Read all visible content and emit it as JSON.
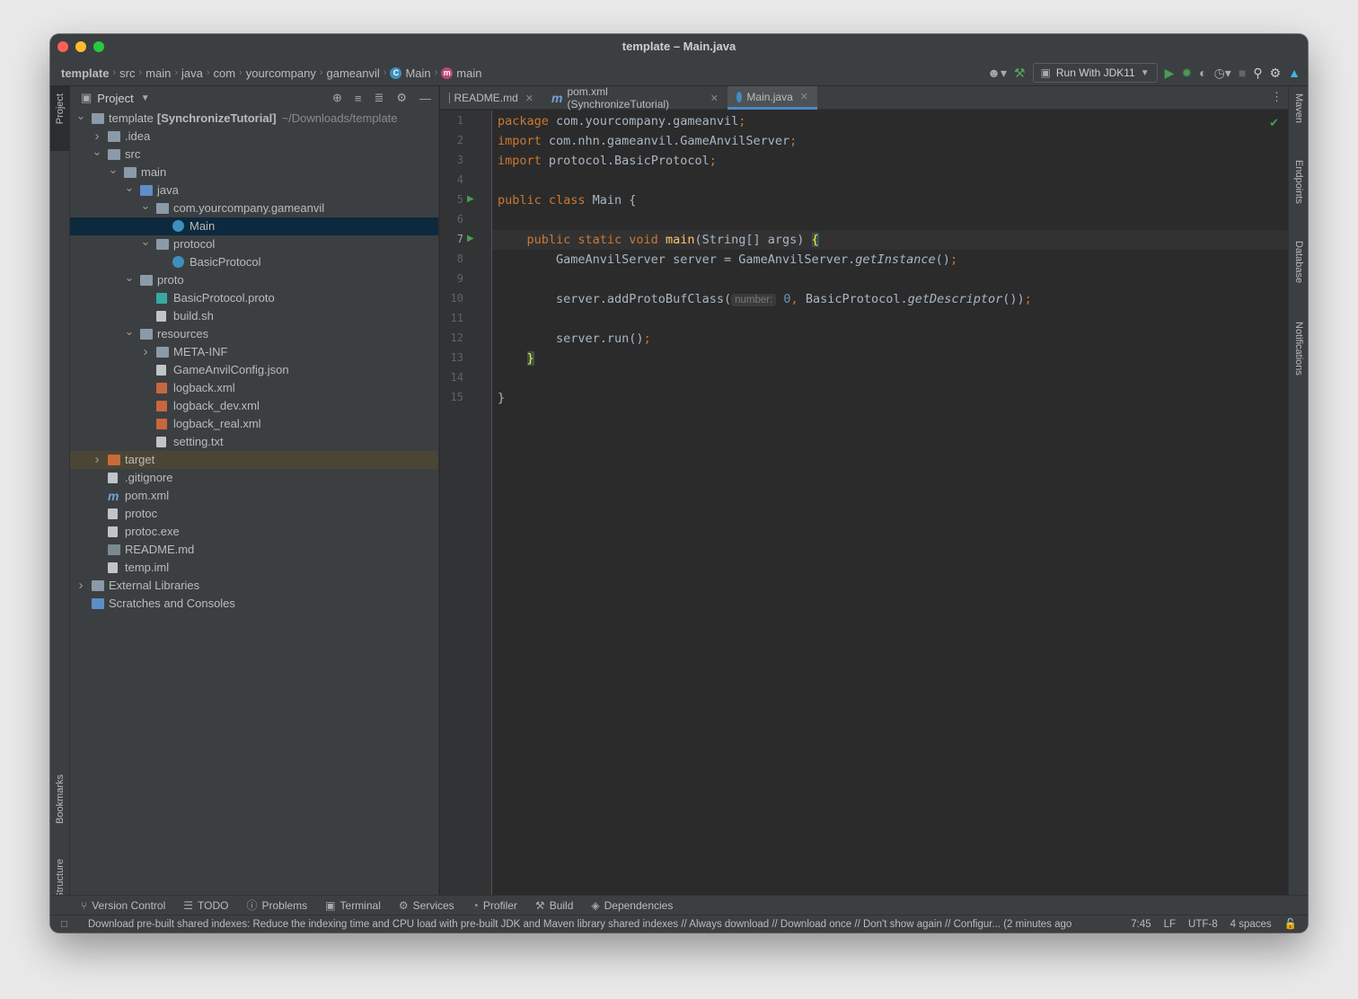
{
  "window": {
    "title": "template – Main.java"
  },
  "breadcrumbs": [
    "template",
    "src",
    "main",
    "java",
    "com",
    "yourcompany",
    "gameanvil",
    "Main",
    "main"
  ],
  "toolbar": {
    "run_config": "Run With JDK11"
  },
  "left_strip": {
    "project": "Project",
    "bookmarks": "Bookmarks",
    "structure": "Structure"
  },
  "right_strip": {
    "maven": "Maven",
    "endpoints": "Endpoints",
    "database": "Database",
    "notifications": "Notifications"
  },
  "project_panel": {
    "title": "Project",
    "tree": [
      {
        "depth": 0,
        "arrow": "open",
        "icon": "module-folder",
        "label": "template",
        "bold": "[SynchronizeTutorial]",
        "dim": "~/Downloads/template"
      },
      {
        "depth": 1,
        "arrow": "closed",
        "icon": "folder",
        "label": ".idea"
      },
      {
        "depth": 1,
        "arrow": "open",
        "icon": "folder",
        "label": "src"
      },
      {
        "depth": 2,
        "arrow": "open",
        "icon": "folder",
        "label": "main"
      },
      {
        "depth": 3,
        "arrow": "open",
        "icon": "folder-blue",
        "label": "java"
      },
      {
        "depth": 4,
        "arrow": "open",
        "icon": "package",
        "label": "com.yourcompany.gameanvil"
      },
      {
        "depth": 5,
        "arrow": "",
        "icon": "class",
        "label": "Main",
        "selected": true
      },
      {
        "depth": 4,
        "arrow": "open",
        "icon": "package",
        "label": "protocol"
      },
      {
        "depth": 5,
        "arrow": "",
        "icon": "class",
        "label": "BasicProtocol"
      },
      {
        "depth": 3,
        "arrow": "open",
        "icon": "folder",
        "label": "proto"
      },
      {
        "depth": 4,
        "arrow": "",
        "icon": "proto",
        "label": "BasicProtocol.proto"
      },
      {
        "depth": 4,
        "arrow": "",
        "icon": "script",
        "label": "build.sh"
      },
      {
        "depth": 3,
        "arrow": "open",
        "icon": "folder-res",
        "label": "resources"
      },
      {
        "depth": 4,
        "arrow": "closed",
        "icon": "folder",
        "label": "META-INF"
      },
      {
        "depth": 4,
        "arrow": "",
        "icon": "json",
        "label": "GameAnvilConfig.json"
      },
      {
        "depth": 4,
        "arrow": "",
        "icon": "xml",
        "label": "logback.xml"
      },
      {
        "depth": 4,
        "arrow": "",
        "icon": "xml",
        "label": "logback_dev.xml"
      },
      {
        "depth": 4,
        "arrow": "",
        "icon": "xml",
        "label": "logback_real.xml"
      },
      {
        "depth": 4,
        "arrow": "",
        "icon": "text",
        "label": "setting.txt"
      },
      {
        "depth": 1,
        "arrow": "closed",
        "icon": "folder-orange",
        "label": "target",
        "target": true
      },
      {
        "depth": 1,
        "arrow": "",
        "icon": "gitignore",
        "label": ".gitignore"
      },
      {
        "depth": 1,
        "arrow": "",
        "icon": "maven",
        "label": "pom.xml"
      },
      {
        "depth": 1,
        "arrow": "",
        "icon": "file",
        "label": "protoc"
      },
      {
        "depth": 1,
        "arrow": "",
        "icon": "file",
        "label": "protoc.exe"
      },
      {
        "depth": 1,
        "arrow": "",
        "icon": "md",
        "label": "README.md"
      },
      {
        "depth": 1,
        "arrow": "",
        "icon": "iml",
        "label": "temp.iml"
      },
      {
        "depth": 0,
        "arrow": "closed",
        "icon": "libraries",
        "label": "External Libraries"
      },
      {
        "depth": 0,
        "arrow": "",
        "icon": "scratches",
        "label": "Scratches and Consoles"
      }
    ]
  },
  "tabs": [
    {
      "label": "README.md",
      "icon": "md"
    },
    {
      "label": "pom.xml (SynchronizeTutorial)",
      "icon": "maven"
    },
    {
      "label": "Main.java",
      "icon": "class",
      "active": true
    }
  ],
  "editor": {
    "current_line": 7,
    "lines": [
      {
        "n": "1",
        "t": [
          [
            "kw",
            "package "
          ],
          [
            "",
            "com.yourcompany.gameanvil"
          ],
          [
            "kw",
            ";"
          ]
        ]
      },
      {
        "n": "2",
        "t": [
          [
            "kw",
            "import "
          ],
          [
            "",
            "com.nhn.gameanvil.GameAnvilServer"
          ],
          [
            "kw",
            ";"
          ]
        ]
      },
      {
        "n": "3",
        "t": [
          [
            "kw",
            "import "
          ],
          [
            "",
            "protocol.BasicProtocol"
          ],
          [
            "kw",
            ";"
          ]
        ]
      },
      {
        "n": "4",
        "t": []
      },
      {
        "n": "5",
        "run": true,
        "t": [
          [
            "kw",
            "public class "
          ],
          [
            "",
            "Main {"
          ]
        ]
      },
      {
        "n": "6",
        "t": []
      },
      {
        "n": "7",
        "run": true,
        "t": [
          [
            "",
            "    "
          ],
          [
            "kw",
            "public static void "
          ],
          [
            "fn",
            "main"
          ],
          [
            "",
            "(String[] args) "
          ],
          [
            "brace",
            "{"
          ]
        ]
      },
      {
        "n": "8",
        "t": [
          [
            "",
            "        GameAnvilServer server = GameAnvilServer."
          ],
          [
            "it",
            "getInstance"
          ],
          [
            "",
            "()"
          ],
          [
            "kw",
            ";"
          ]
        ]
      },
      {
        "n": "9",
        "t": []
      },
      {
        "n": "10",
        "t": [
          [
            "",
            "        server.addProtoBufClass("
          ],
          [
            "hint",
            "number:"
          ],
          [
            "num",
            " 0"
          ],
          [
            "kw",
            ", "
          ],
          [
            "",
            "BasicProtocol."
          ],
          [
            "it",
            "getDescriptor"
          ],
          [
            "",
            "())"
          ],
          [
            "kw",
            ";"
          ]
        ]
      },
      {
        "n": "11",
        "t": []
      },
      {
        "n": "12",
        "t": [
          [
            "",
            "        server.run()"
          ],
          [
            "kw",
            ";"
          ]
        ]
      },
      {
        "n": "13",
        "t": [
          [
            "",
            "    "
          ],
          [
            "brace",
            "}"
          ]
        ]
      },
      {
        "n": "14",
        "t": []
      },
      {
        "n": "15",
        "t": [
          [
            "",
            "}"
          ]
        ]
      }
    ]
  },
  "bottom_tools": [
    "Version Control",
    "TODO",
    "Problems",
    "Terminal",
    "Services",
    "Profiler",
    "Build",
    "Dependencies"
  ],
  "status": {
    "message": "Download pre-built shared indexes: Reduce the indexing time and CPU load with pre-built JDK and Maven library shared indexes // Always download // Download once // Don't show again // Configur... (2 minutes ago",
    "position": "7:45",
    "line_sep": "LF",
    "encoding": "UTF-8",
    "indent": "4 spaces"
  },
  "colors": {
    "accent": "#4a88c7",
    "selection": "#0d293e",
    "run_green": "#499c54",
    "keyword": "#cc7832",
    "function": "#ffc66d"
  }
}
